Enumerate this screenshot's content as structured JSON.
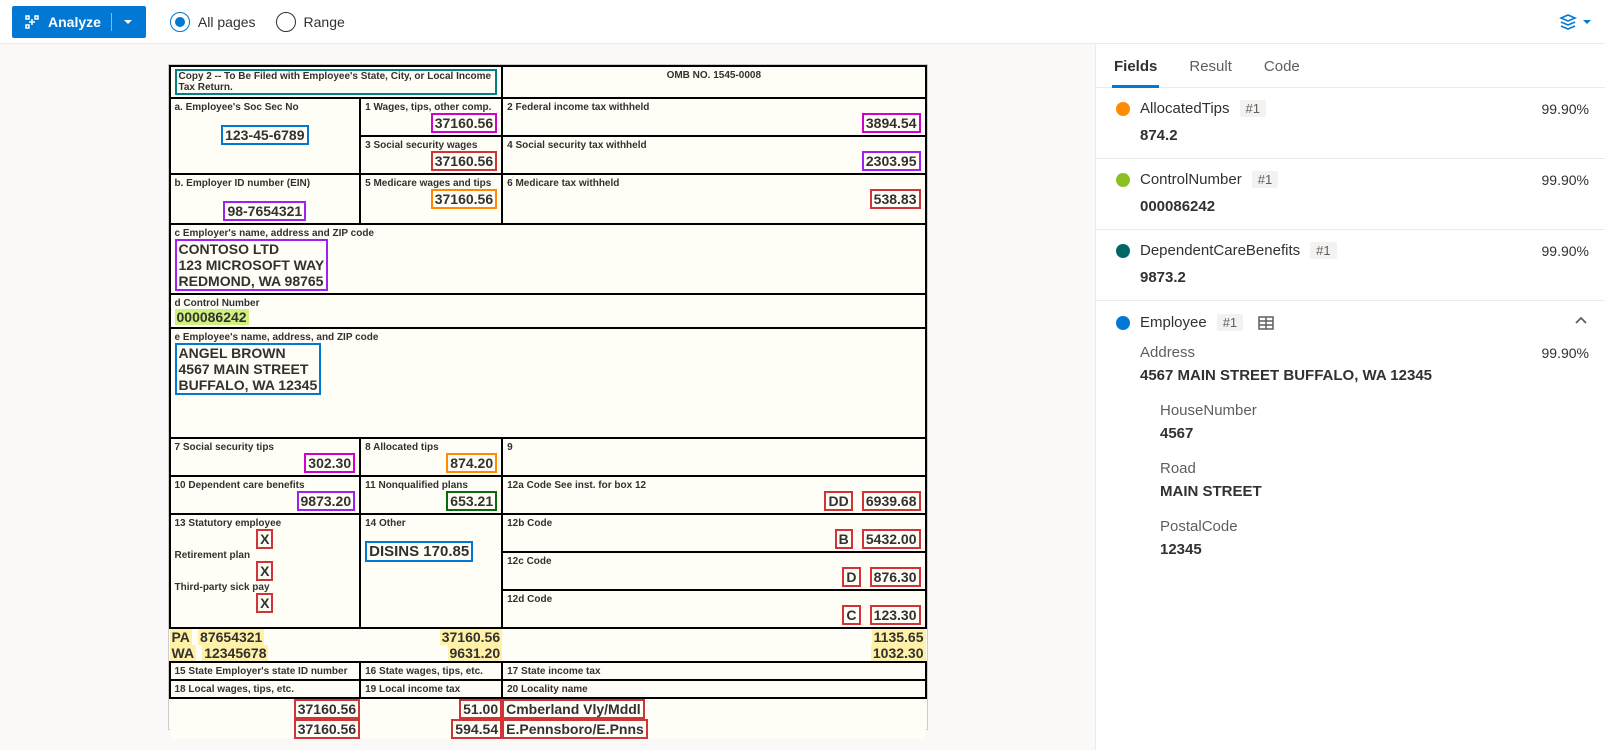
{
  "toolbar": {
    "analyze_label": "Analyze",
    "all_pages_label": "All pages",
    "range_label": "Range"
  },
  "tabs": {
    "fields": "Fields",
    "result": "Result",
    "code": "Code"
  },
  "doc": {
    "copy_note": "Copy 2 -- To Be Filed with Employee's State, City, or Local Income Tax Return.",
    "omb": "OMB NO. 1545-0008",
    "a_label": "a. Employee's Soc Sec No",
    "ssn": "123-45-6789",
    "b_label": "b. Employer ID number (EIN)",
    "ein": "98-7654321",
    "c_label": "c Employer's name, address and ZIP code",
    "c_l1": "CONTOSO LTD",
    "c_l2": "123 MICROSOFT WAY",
    "c_l3": "REDMOND, WA 98765",
    "d_label": "d Control Number",
    "control": "000086242",
    "e_label": "e Employee's name, address, and ZIP code",
    "e_l1": "ANGEL BROWN",
    "e_l2": "4567 MAIN STREET",
    "e_l3": "BUFFALO, WA 12345",
    "box1_label": "1 Wages, tips, other comp.",
    "box1": "37160.56",
    "box2_label": "2 Federal income tax withheld",
    "box2": "3894.54",
    "box3_label": "3 Social security wages",
    "box3": "37160.56",
    "box4_label": "4 Social security tax withheld",
    "box4": "2303.95",
    "box5_label": "5 Medicare wages and tips",
    "box5": "37160.56",
    "box6_label": "6 Medicare tax withheld",
    "box6": "538.83",
    "box7_label": "7 Social security tips",
    "box7": "302.30",
    "box8_label": "8 Allocated tips",
    "box8": "874.20",
    "box9_label": "9",
    "box10_label": "10 Dependent care benefits",
    "box10": "9873.20",
    "box11_label": "11 Nonqualified plans",
    "box11": "653.21",
    "box12a_label": "12a Code See inst. for box 12",
    "box12a_code": "DD",
    "box12a_val": "6939.68",
    "box12b_label": "12b Code",
    "box12b_code": "B",
    "box12b_val": "5432.00",
    "box12c_label": "12c Code",
    "box12c_code": "D",
    "box12c_val": "876.30",
    "box12d_label": "12d Code",
    "box12d_code": "C",
    "box12d_val": "123.30",
    "box13_label": "13 Statutory employee",
    "box13_x": "X",
    "retire_label": "Retirement plan",
    "retire_x": "X",
    "third_label": "Third-party sick pay",
    "third_x": "X",
    "box14_label": "14 Other",
    "box14": "DISINS    170.85",
    "st1": "PA",
    "stid1": "87654321",
    "stw1": "37160.56",
    "stt1": "1135.65",
    "st2": "WA",
    "stid2": "12345678",
    "stw2": "9631.20",
    "stt2": "1032.30",
    "box15_label": "15 State Employer's state ID number",
    "box16_label": "16 State wages, tips, etc.",
    "box17_label": "17 State income tax",
    "box18_label": "18 Local wages, tips, etc.",
    "box19_label": "19 Local income tax",
    "box20_label": "20 Locality name",
    "lw1": "37160.56",
    "lt1": "51.00",
    "loc1": "Cmberland Vly/Mddl",
    "lw2": "37160.56",
    "lt2": "594.54",
    "loc2": "E.Pennsboro/E.Pnns"
  },
  "fields": {
    "allocated_tips": {
      "name": "AllocatedTips",
      "badge": "#1",
      "conf": "99.90%",
      "value": "874.2"
    },
    "control_number": {
      "name": "ControlNumber",
      "badge": "#1",
      "conf": "99.90%",
      "value": "000086242"
    },
    "dependent_care": {
      "name": "DependentCareBenefits",
      "badge": "#1",
      "conf": "99.90%",
      "value": "9873.2"
    },
    "employee": {
      "name": "Employee",
      "badge": "#1"
    },
    "employee_address": {
      "name": "Address",
      "conf": "99.90%",
      "value": "4567 MAIN STREET BUFFALO, WA 12345"
    },
    "house_number": {
      "name": "HouseNumber",
      "value": "4567"
    },
    "road": {
      "name": "Road",
      "value": "MAIN STREET"
    },
    "postal": {
      "name": "PostalCode",
      "value": "12345"
    }
  }
}
